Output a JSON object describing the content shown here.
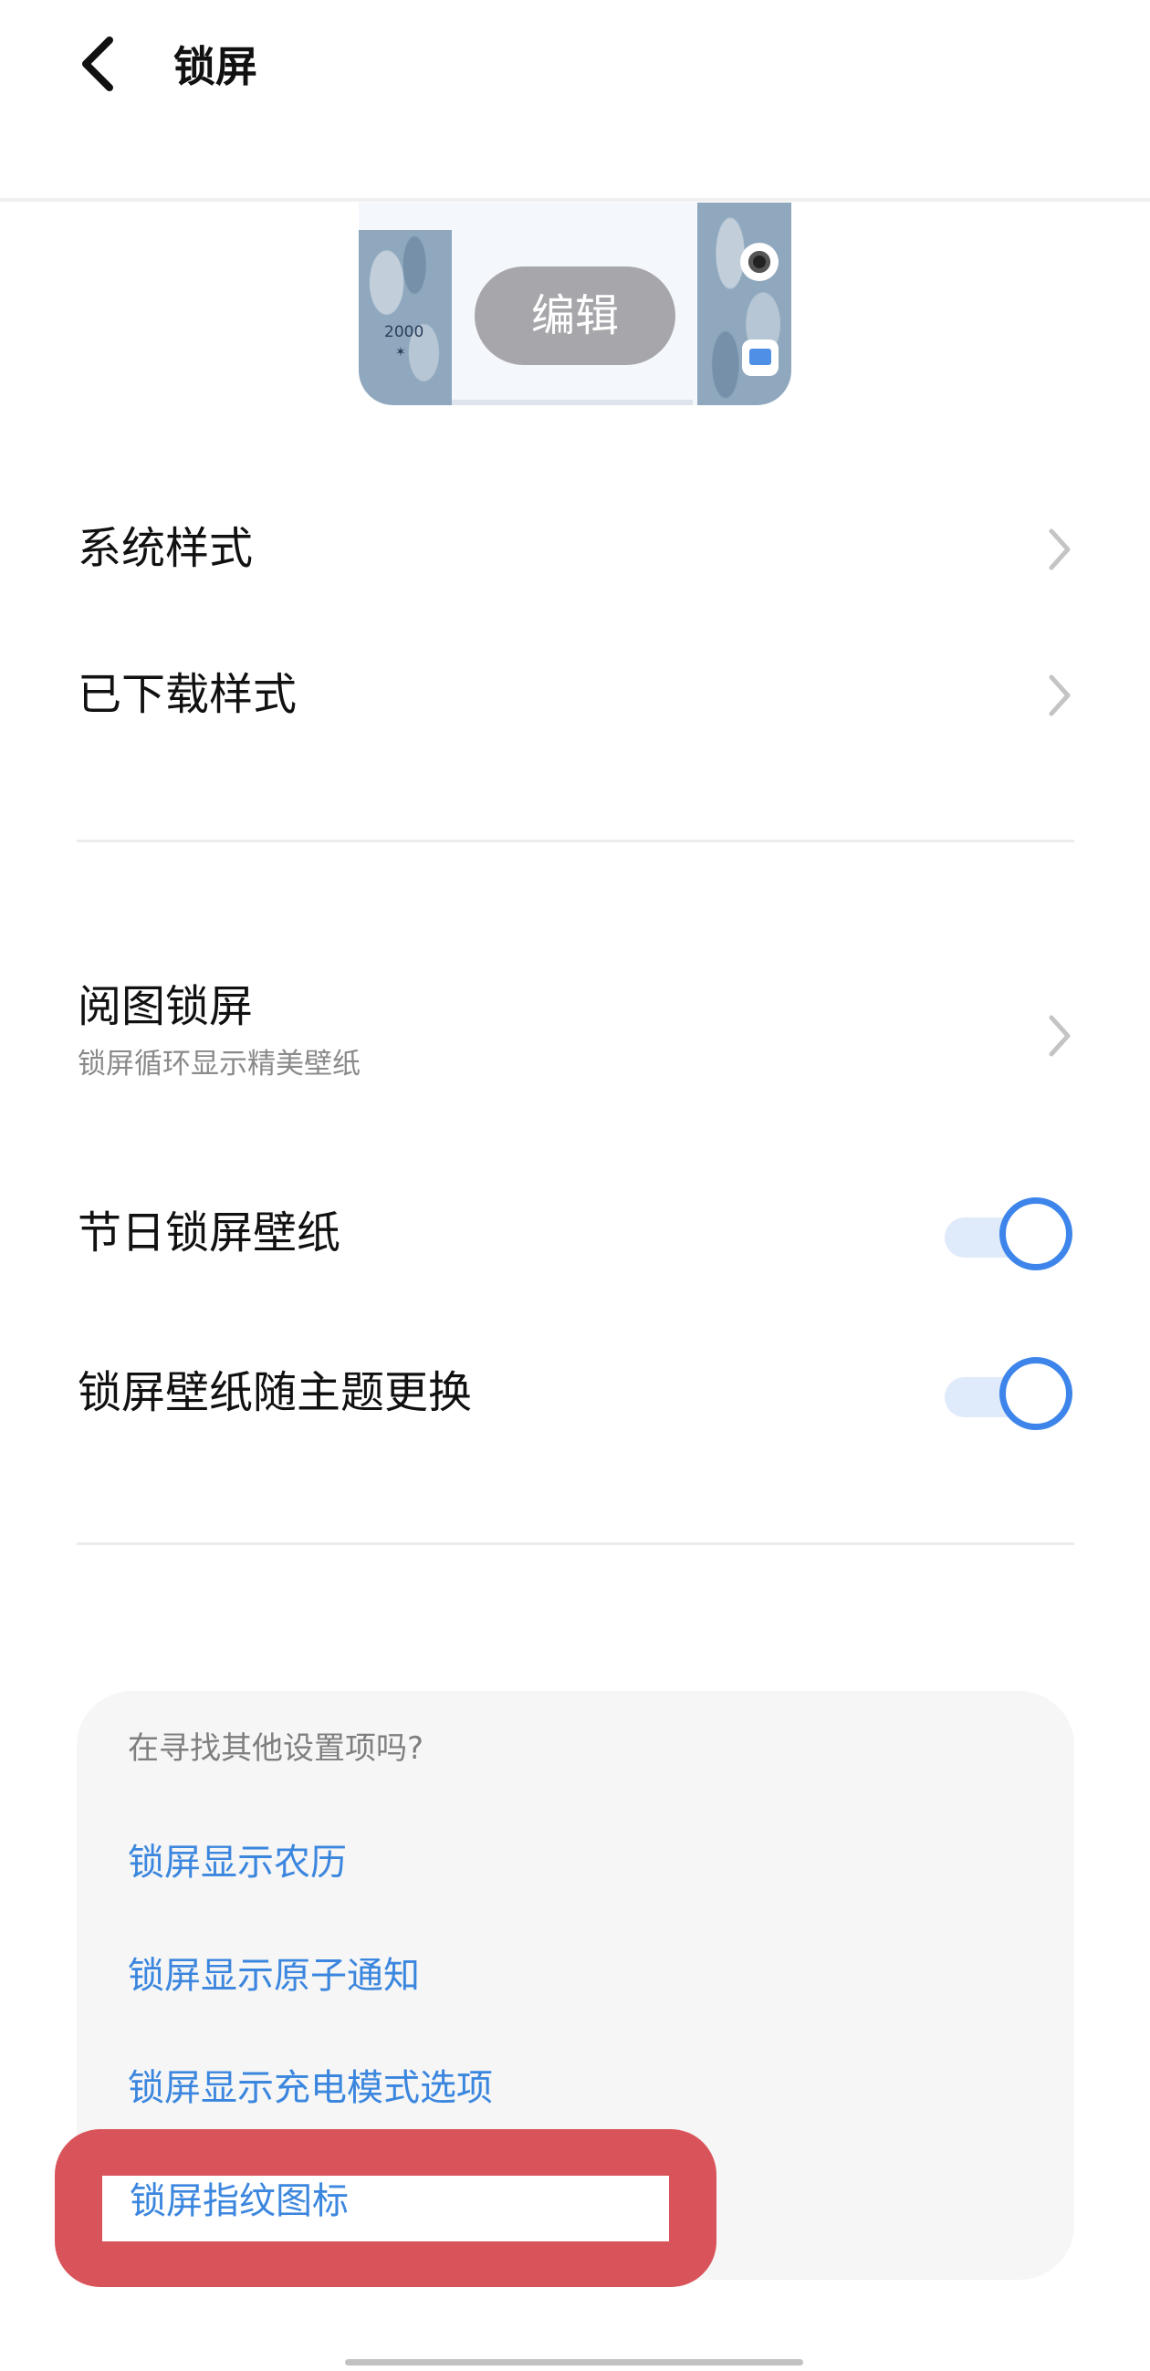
{
  "header": {
    "title": "锁屏",
    "back_icon": "chevron-left-icon"
  },
  "preview": {
    "edit_label": "编辑",
    "clock_text": "2000"
  },
  "style_section": {
    "items": [
      {
        "label": "系统样式"
      },
      {
        "label": "已下载样式"
      }
    ]
  },
  "wallpaper_section": {
    "reader_lockscreen": {
      "label": "阅图锁屏",
      "subtitle": "锁屏循环显示精美壁纸"
    },
    "festival_wallpaper": {
      "label": "节日锁屏壁纸",
      "enabled": true
    },
    "follow_theme": {
      "label": "锁屏壁纸随主题更换",
      "enabled": true
    }
  },
  "search_suggestions": {
    "hint": "在寻找其他设置项吗?",
    "links": [
      {
        "label": "锁屏显示农历"
      },
      {
        "label": "锁屏显示原子通知"
      },
      {
        "label": "锁屏显示充电模式选项"
      },
      {
        "label": "锁屏指纹图标"
      }
    ]
  },
  "colors": {
    "accent": "#3d85ea",
    "link": "#3b86de",
    "highlight": "#d9545a",
    "toggle_track": "#dfeafb"
  }
}
